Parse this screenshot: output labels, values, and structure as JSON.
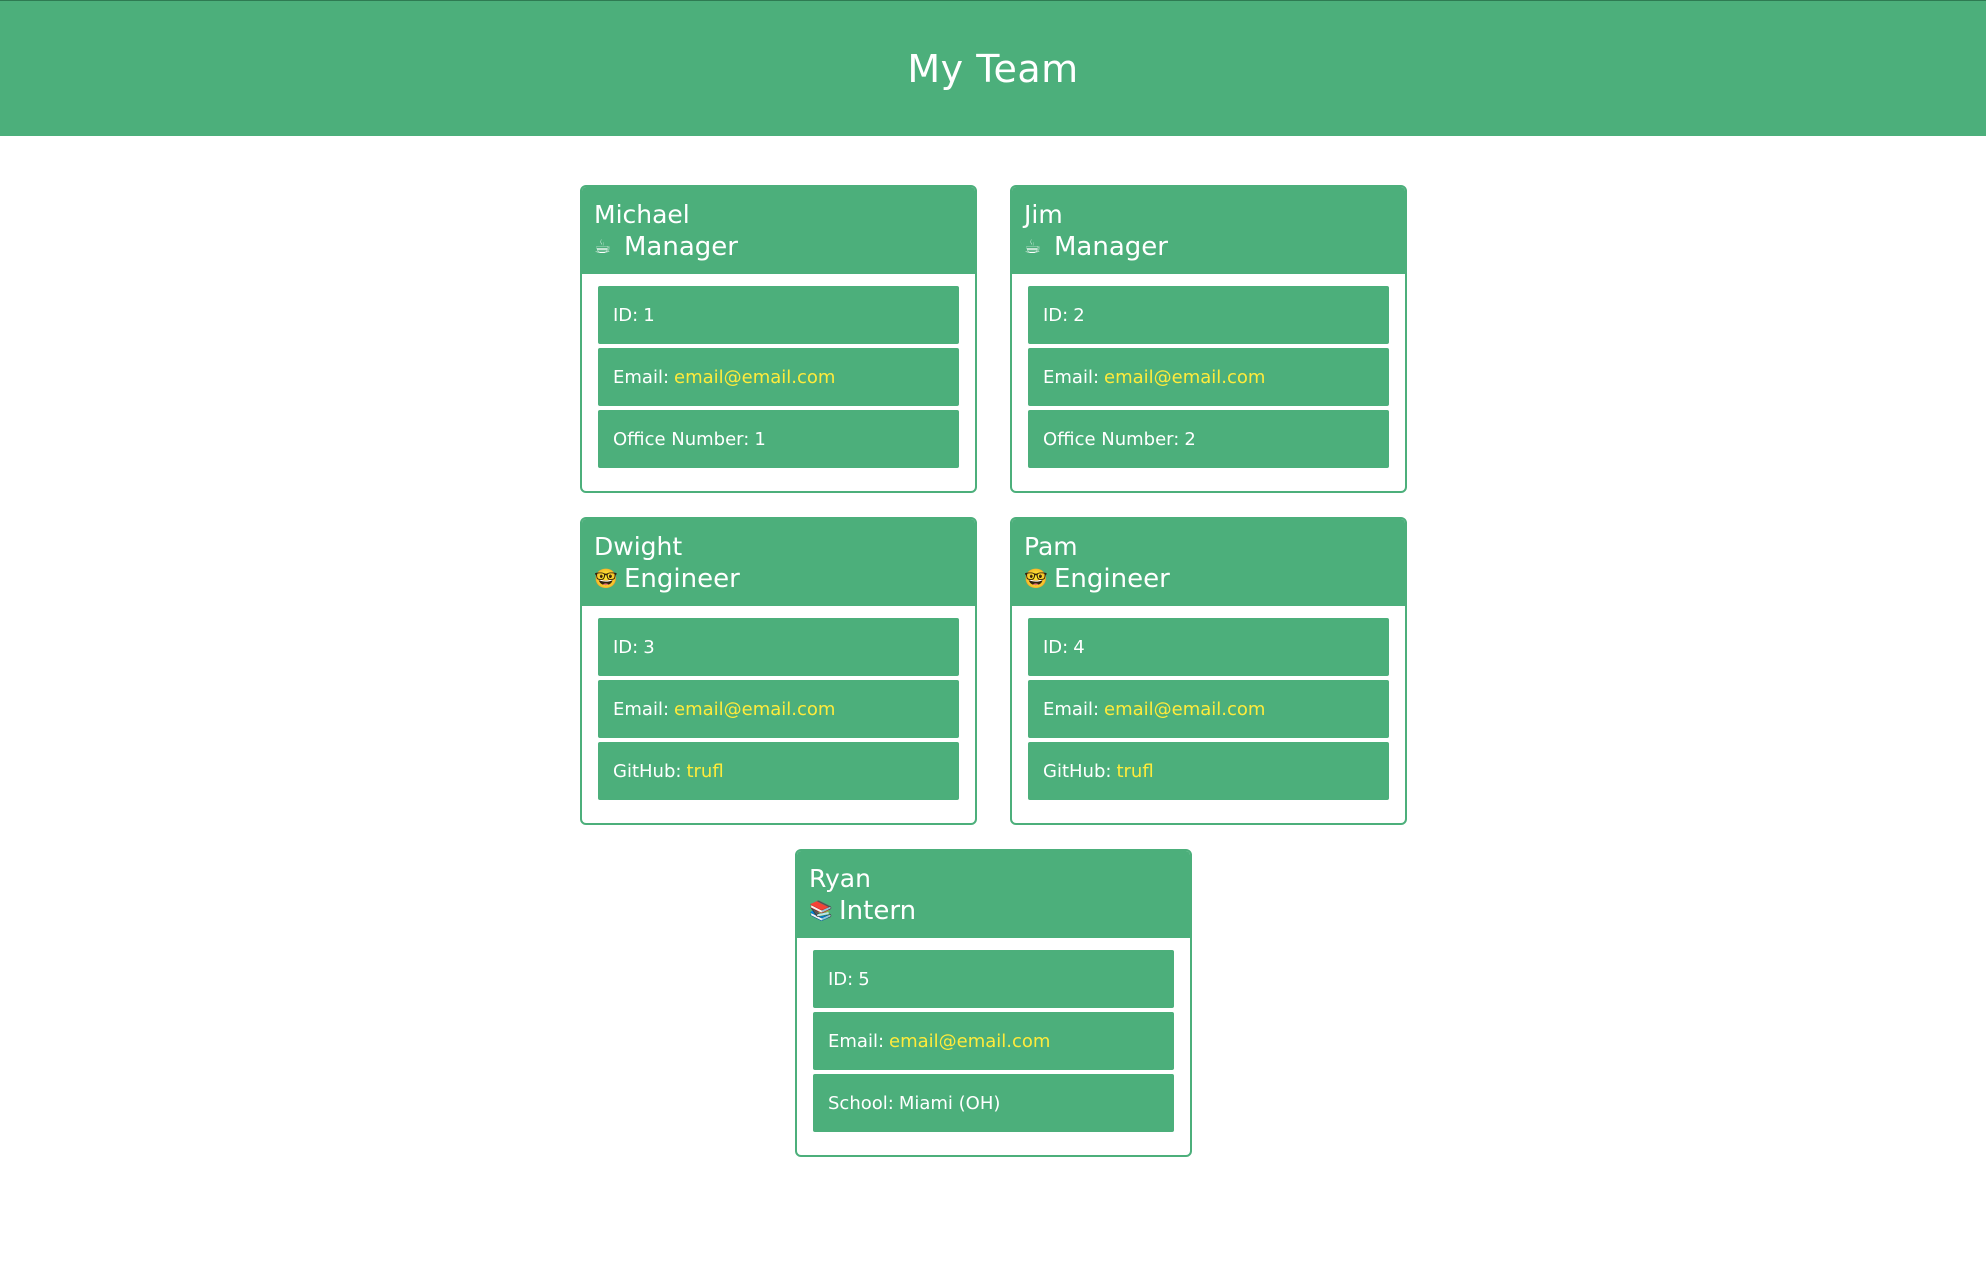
{
  "header": {
    "title": "My Team"
  },
  "colors": {
    "accent": "#4caf7b",
    "link": "#ffeb3b"
  },
  "members": [
    {
      "name": "Michael",
      "role": "Manager",
      "role_icon": "coffee-icon",
      "id_label": "ID:",
      "id": "1",
      "email_label": "Email:",
      "email": "email@email.com",
      "extra_label": "Office Number:",
      "extra_value": "1"
    },
    {
      "name": "Jim",
      "role": "Manager",
      "role_icon": "coffee-icon",
      "id_label": "ID:",
      "id": "2",
      "email_label": "Email:",
      "email": "email@email.com",
      "extra_label": "Office Number:",
      "extra_value": "2"
    },
    {
      "name": "Dwight",
      "role": "Engineer",
      "role_icon": "nerd-face-icon",
      "id_label": "ID:",
      "id": "3",
      "email_label": "Email:",
      "email": "email@email.com",
      "extra_label": "GitHub:",
      "extra_value": "trufl"
    },
    {
      "name": "Pam",
      "role": "Engineer",
      "role_icon": "nerd-face-icon",
      "id_label": "ID:",
      "id": "4",
      "email_label": "Email:",
      "email": "email@email.com",
      "extra_label": "GitHub:",
      "extra_value": "trufl"
    },
    {
      "name": "Ryan",
      "role": "Intern",
      "role_icon": "books-icon",
      "id_label": "ID:",
      "id": "5",
      "email_label": "Email:",
      "email": "email@email.com",
      "extra_label": "School:",
      "extra_value": "Miami (OH)"
    }
  ]
}
